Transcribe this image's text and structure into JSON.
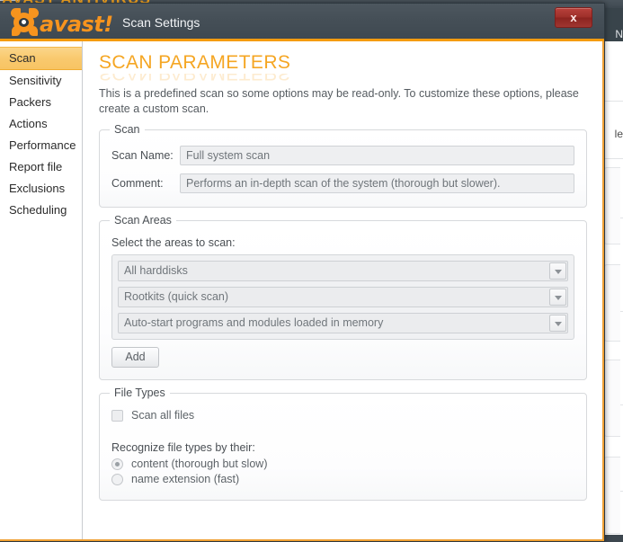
{
  "background": {
    "top_strip_text": "AVAST ANTIVIRUS",
    "right_label_top": "N",
    "right_label_mid": "le"
  },
  "titlebar": {
    "brand": "avast!",
    "title": "Scan Settings",
    "close_label": "x",
    "accent_color": "#f59c10",
    "bar_color": "#454f57"
  },
  "sidebar": {
    "items": [
      {
        "label": "Scan",
        "active": true
      },
      {
        "label": "Sensitivity",
        "active": false
      },
      {
        "label": "Packers",
        "active": false
      },
      {
        "label": "Actions",
        "active": false
      },
      {
        "label": "Performance",
        "active": false
      },
      {
        "label": "Report file",
        "active": false
      },
      {
        "label": "Exclusions",
        "active": false
      },
      {
        "label": "Scheduling",
        "active": false
      }
    ]
  },
  "page": {
    "title": "SCAN PARAMETERS",
    "description": "This is a predefined scan so some options may be read-only. To customize these options, please create a custom scan."
  },
  "scan_group": {
    "title": "Scan",
    "scan_name_label": "Scan Name:",
    "scan_name_value": "Full system scan",
    "comment_label": "Comment:",
    "comment_value": "Performs an in-depth scan of the system (thorough but slower)."
  },
  "scan_areas_group": {
    "title": "Scan Areas",
    "instruction": "Select the areas to scan:",
    "areas": [
      "All harddisks",
      "Rootkits (quick scan)",
      "Auto-start programs and modules loaded in memory"
    ],
    "add_label": "Add"
  },
  "file_types_group": {
    "title": "File Types",
    "scan_all_files_label": "Scan all files",
    "scan_all_files_checked": false,
    "recognize_label": "Recognize file types by their:",
    "options": [
      {
        "label": "content (thorough but slow)",
        "selected": true
      },
      {
        "label": "name extension (fast)",
        "selected": false
      }
    ]
  }
}
